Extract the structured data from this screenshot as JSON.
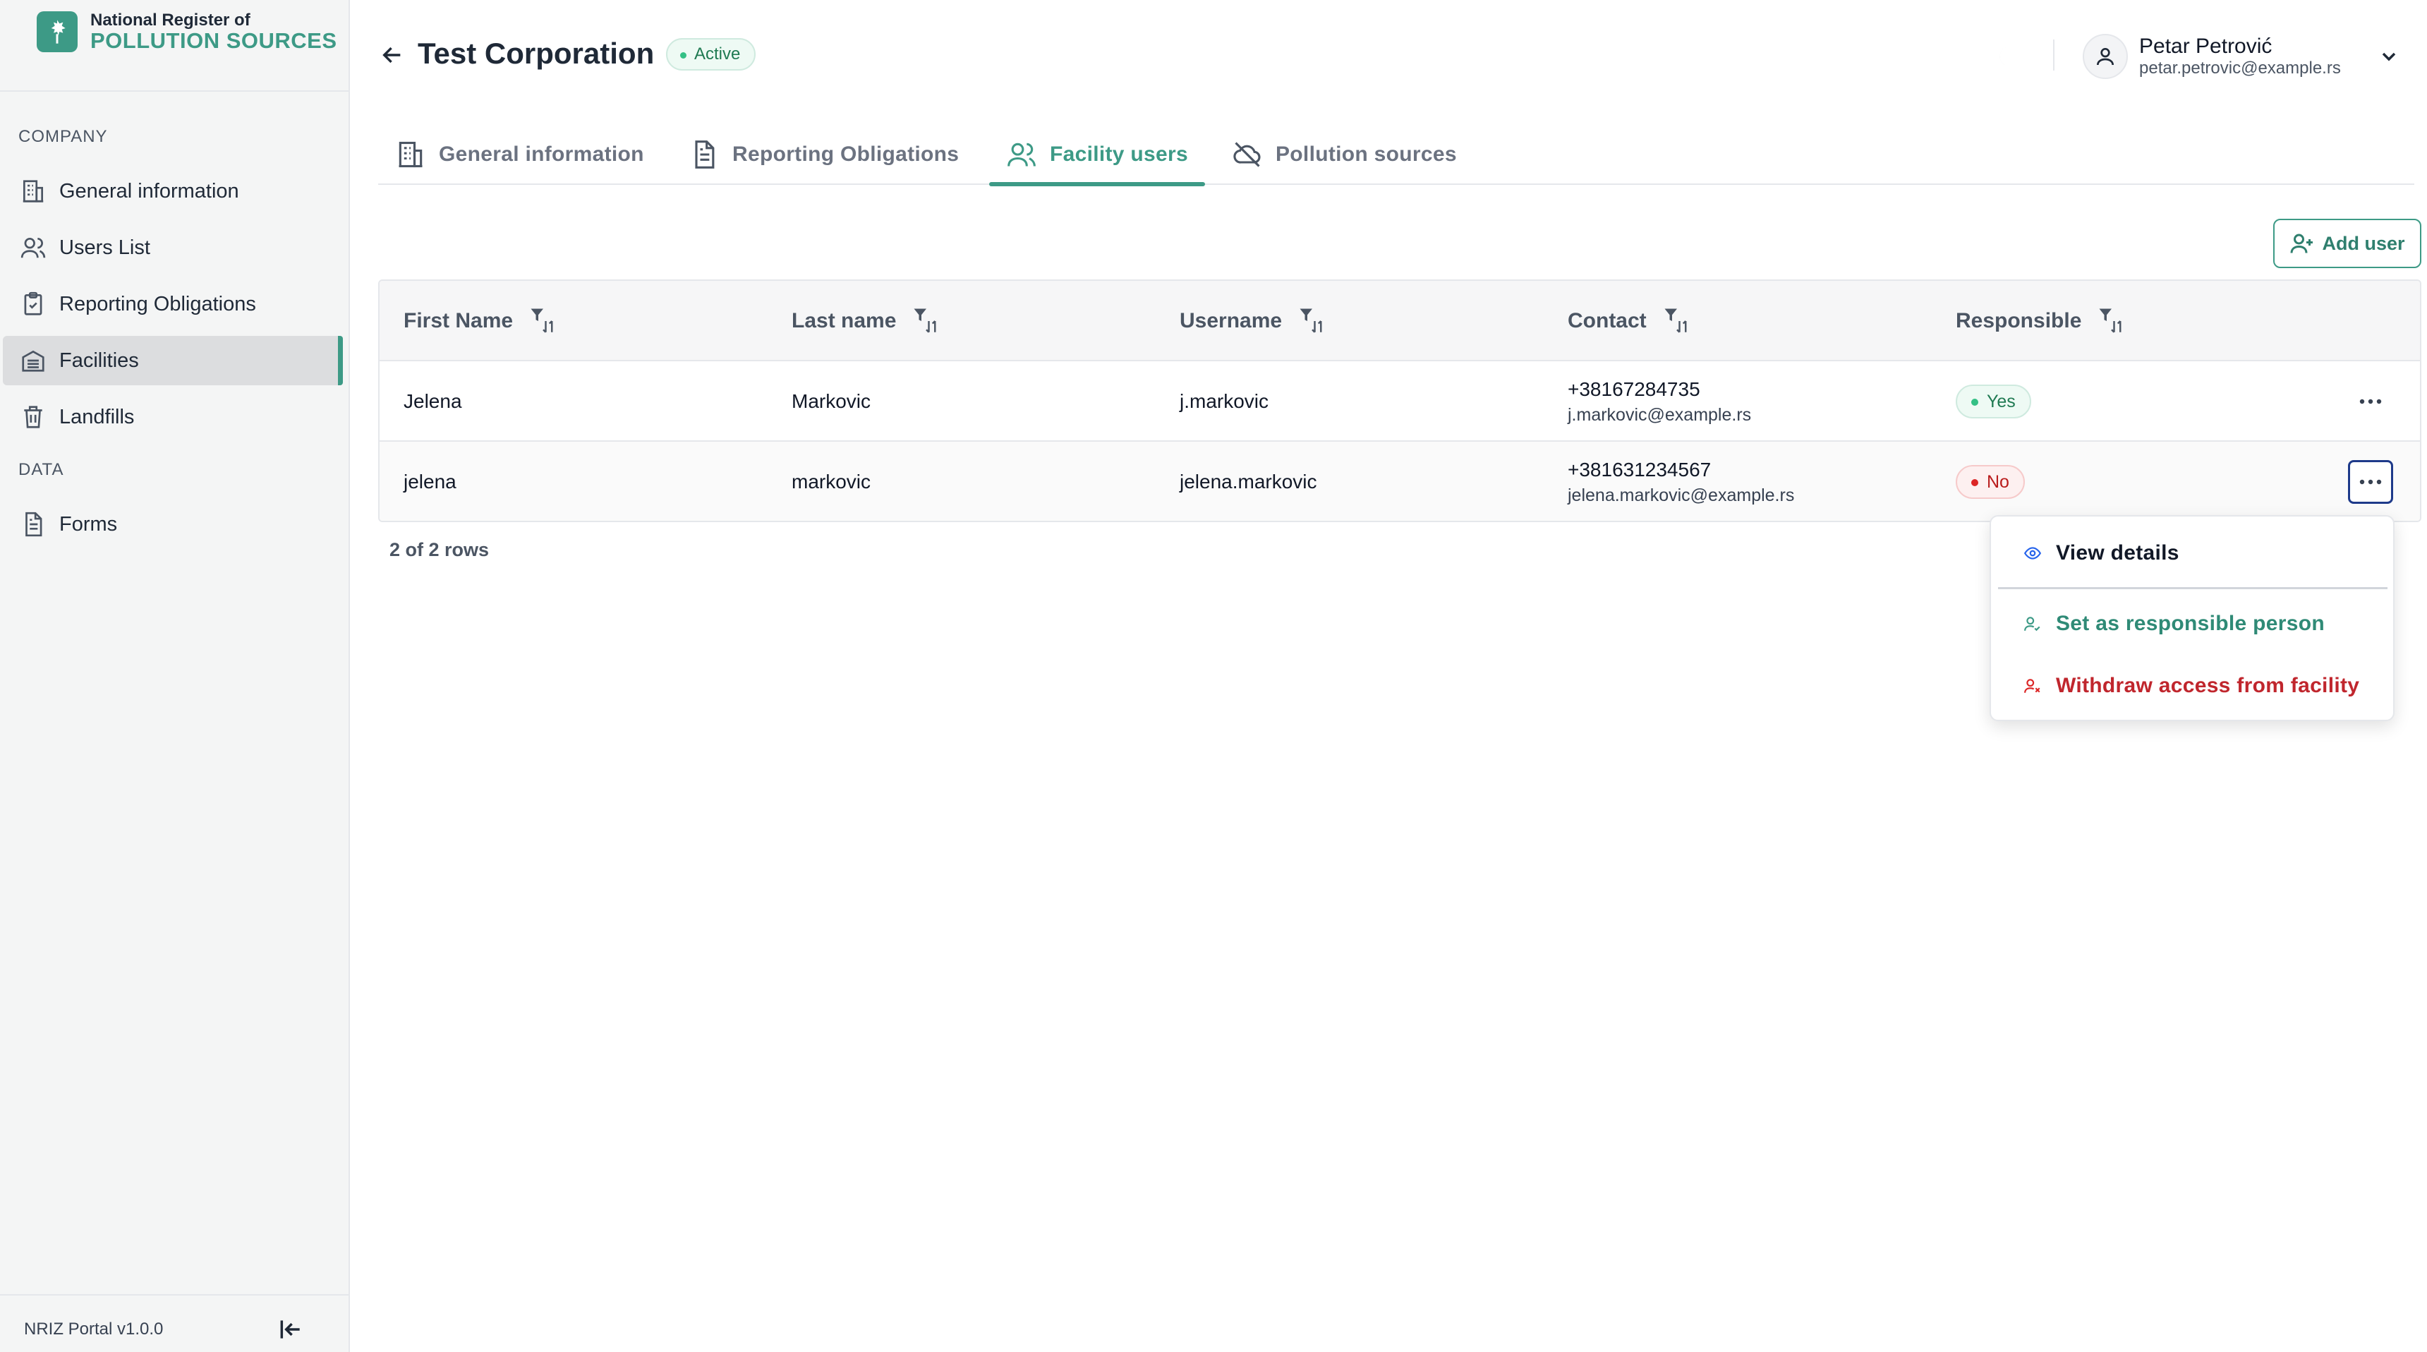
{
  "brand": {
    "line1": "National Register of",
    "line2": "POLLUTION SOURCES",
    "accent": "#3d9a86"
  },
  "sidebar": {
    "sections": [
      {
        "label": "COMPANY"
      },
      {
        "label": "DATA"
      }
    ],
    "items": [
      {
        "label": "General information",
        "icon": "building-icon"
      },
      {
        "label": "Users List",
        "icon": "users-icon"
      },
      {
        "label": "Reporting Obligations",
        "icon": "clipboard-check-icon"
      },
      {
        "label": "Facilities",
        "icon": "facility-icon",
        "active": true
      },
      {
        "label": "Landfills",
        "icon": "trash-icon"
      },
      {
        "label": "Forms",
        "icon": "document-icon"
      }
    ],
    "version": "NRIZ Portal v1.0.0"
  },
  "header": {
    "title": "Test Corporation",
    "status": "Active",
    "user": {
      "name": "Petar Petrović",
      "email": "petar.petrovic@example.rs"
    }
  },
  "tabs": [
    {
      "label": "General information",
      "icon": "building-icon"
    },
    {
      "label": "Reporting Obligations",
      "icon": "document-icon"
    },
    {
      "label": "Facility users",
      "icon": "users-icon",
      "active": true
    },
    {
      "label": "Pollution sources",
      "icon": "cloud-off-icon"
    }
  ],
  "toolbar": {
    "add_user_label": "Add user"
  },
  "table": {
    "columns": [
      "First Name",
      "Last name",
      "Username",
      "Contact",
      "Responsible"
    ],
    "rows": [
      {
        "first_name": "Jelena",
        "last_name": "Markovic",
        "username": "j.markovic",
        "phone": "+38167284735",
        "email": "j.markovic@example.rs",
        "responsible": "Yes"
      },
      {
        "first_name": "jelena",
        "last_name": "markovic",
        "username": "jelena.markovic",
        "phone": "+381631234567",
        "email": "jelena.markovic@example.rs",
        "responsible": "No"
      }
    ],
    "rows_count": "2 of 2 rows"
  },
  "row_menu": {
    "view_details": "View details",
    "set_responsible": "Set as responsible person",
    "withdraw_access": "Withdraw access from facility"
  },
  "colors": {
    "accent": "#3d9a86",
    "success": "#1f7a52",
    "danger": "#c0262d",
    "focus": "#1e3a8a"
  }
}
